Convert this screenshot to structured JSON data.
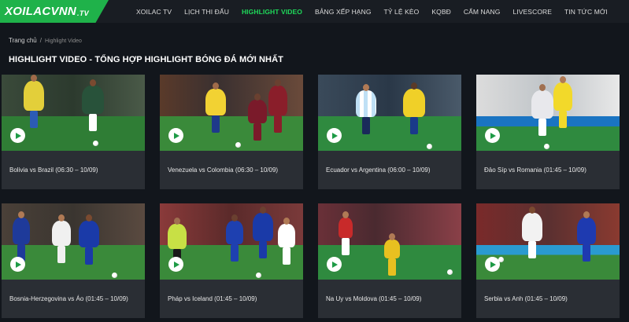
{
  "header": {
    "logo_main": "XOILACVNN",
    "logo_suffix": ".TV",
    "nav": [
      {
        "label": "XOILAC TV",
        "active": false
      },
      {
        "label": "LỊCH THI ĐẤU",
        "active": false
      },
      {
        "label": "HIGHLIGHT VIDEO",
        "active": true
      },
      {
        "label": "BẢNG XẾP HẠNG",
        "active": false
      },
      {
        "label": "TỶ LỆ KÈO",
        "active": false
      },
      {
        "label": "KQBĐ",
        "active": false
      },
      {
        "label": "CẨM NANG",
        "active": false
      },
      {
        "label": "LIVESCORE",
        "active": false
      },
      {
        "label": "TIN TỨC MỚI",
        "active": false
      }
    ]
  },
  "breadcrumb": {
    "home": "Trang chủ",
    "separator": "/",
    "current": "Highlight Video"
  },
  "page_title": "HIGHLIGHT VIDEO - TỔNG HỢP HIGHLIGHT BÓNG ĐÁ MỚI NHẤT",
  "videos": [
    {
      "title": "Bolivia vs Brazil (06:30 – 10/09)"
    },
    {
      "title": "Venezuela vs Colombia (06:30 – 10/09)"
    },
    {
      "title": "Ecuador vs Argentina (06:00 – 10/09)"
    },
    {
      "title": "Đảo Síp vs Romania (01:45 – 10/09)"
    },
    {
      "title": "Bosnia-Herzegovina vs Áo (01:45 – 10/09)"
    },
    {
      "title": "Pháp vs Iceland (01:45 – 10/09)"
    },
    {
      "title": "Na Uy vs Moldova (01:45 – 10/09)"
    },
    {
      "title": "Serbia vs Anh (01:45 – 10/09)"
    }
  ],
  "colors": {
    "brand_green": "#1fb24a",
    "active_nav": "#1fd95a",
    "background": "#12161c",
    "card": "#2a2e34"
  },
  "icons": {
    "play": "play-icon"
  }
}
